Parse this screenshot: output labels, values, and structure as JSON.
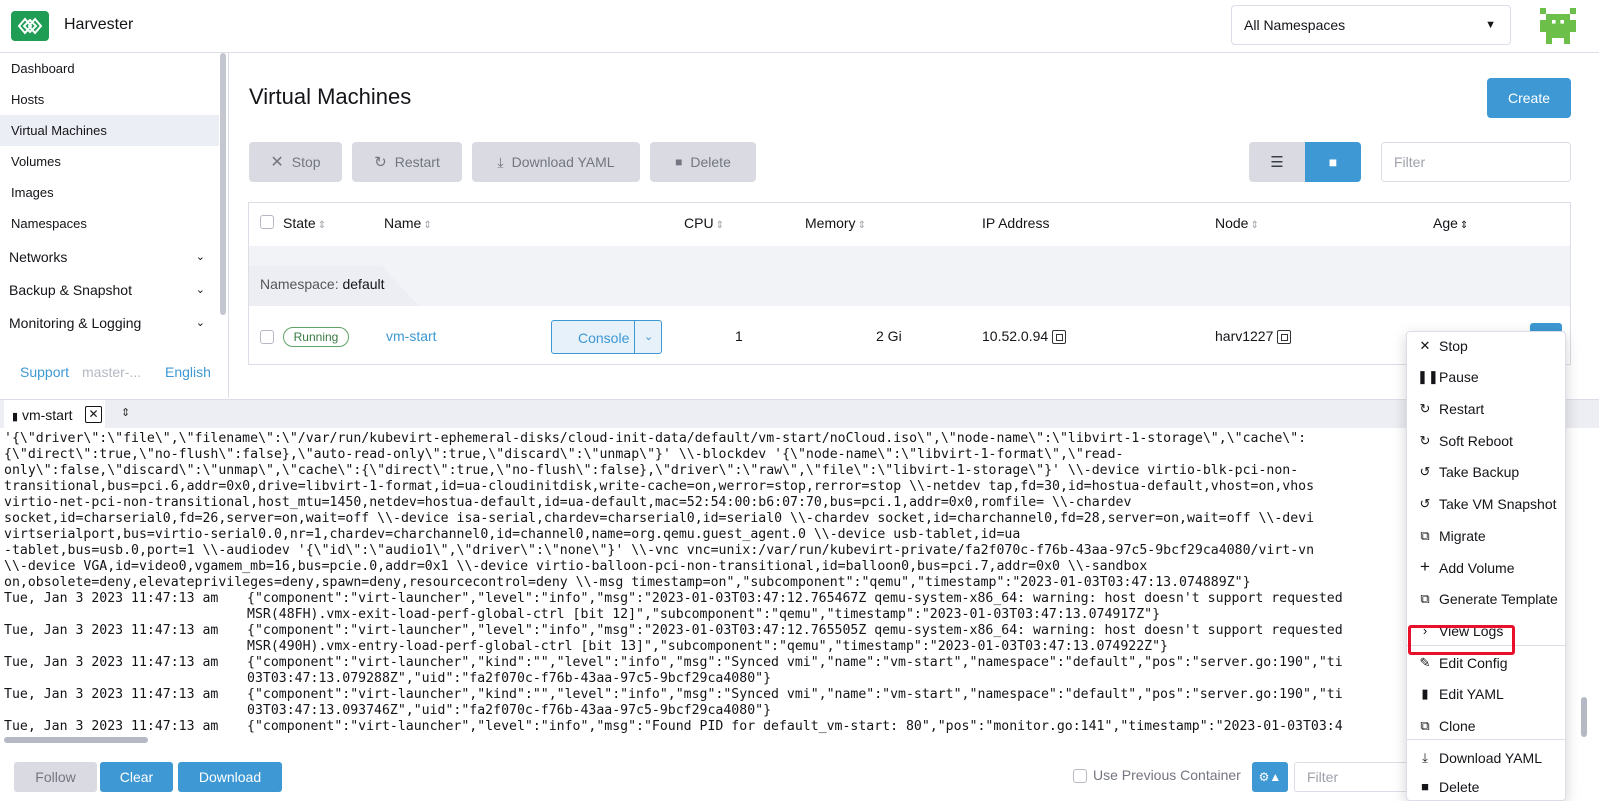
{
  "header": {
    "app_name": "Harvester",
    "namespace_select": "All Namespaces",
    "brand_color": "#1f9d55",
    "accent_color": "#3d98d3"
  },
  "sidebar": {
    "items": [
      {
        "label": "Dashboard"
      },
      {
        "label": "Hosts"
      },
      {
        "label": "Virtual Machines",
        "active": true
      },
      {
        "label": "Volumes"
      },
      {
        "label": "Images"
      },
      {
        "label": "Namespaces"
      }
    ],
    "groups": [
      {
        "label": "Networks"
      },
      {
        "label": "Backup & Snapshot"
      },
      {
        "label": "Monitoring & Logging"
      }
    ],
    "footer": {
      "support": "Support",
      "version": "master-...",
      "language": "English"
    }
  },
  "main": {
    "title": "Virtual Machines",
    "create_label": "Create",
    "bulk_actions": {
      "stop": "Stop",
      "restart": "Restart",
      "download_yaml": "Download YAML",
      "delete": "Delete"
    },
    "filter_placeholder": "Filter",
    "columns": {
      "state": "State",
      "name": "Name",
      "cpu": "CPU",
      "memory": "Memory",
      "ip": "IP Address",
      "node": "Node",
      "age": "Age"
    },
    "group_label": "Namespace:",
    "group_value": "default",
    "row": {
      "state": "Running",
      "name": "vm-start",
      "console": "Console",
      "cpu": "1",
      "memory": "2 Gi",
      "ip": "10.52.0.94",
      "node": "harv1227"
    }
  },
  "logs": {
    "tab_label": "vm-start",
    "wrapped_lines": [
      "'{\\\"driver\\\":\\\"file\\\",\\\"filename\\\":\\\"/var/run/kubevirt-ephemeral-disks/cloud-init-data/default/vm-start/noCloud.iso\\\",\\\"node-name\\\":\\\"libvirt-1-storage\\\",\\\"cache\\\":",
      "{\\\"direct\\\":true,\\\"no-flush\\\":false},\\\"auto-read-only\\\":true,\\\"discard\\\":\\\"unmap\\\"}' \\\\-blockdev '{\\\"node-name\\\":\\\"libvirt-1-format\\\",\\\"read-",
      "only\\\":false,\\\"discard\\\":\\\"unmap\\\",\\\"cache\\\":{\\\"direct\\\":true,\\\"no-flush\\\":false},\\\"driver\\\":\\\"raw\\\",\\\"file\\\":\\\"libvirt-1-storage\\\"}' \\\\-device virtio-blk-pci-non-",
      "transitional,bus=pci.6,addr=0x0,drive=libvirt-1-format,id=ua-cloudinitdisk,write-cache=on,werror=stop,rerror=stop \\\\-netdev tap,fd=30,id=hostua-default,vhost=on,vhos",
      "virtio-net-pci-non-transitional,host_mtu=1450,netdev=hostua-default,id=ua-default,mac=52:54:00:b6:07:70,bus=pci.1,addr=0x0,romfile= \\\\-chardev",
      "socket,id=charserial0,fd=26,server=on,wait=off \\\\-device isa-serial,chardev=charserial0,id=serial0 \\\\-chardev socket,id=charchannel0,fd=28,server=on,wait=off \\\\-devi",
      "virtserialport,bus=virtio-serial0.0,nr=1,chardev=charchannel0,id=channel0,name=org.qemu.guest_agent.0 \\\\-device usb-tablet,id=ua",
      "-tablet,bus=usb.0,port=1 \\\\-audiodev '{\\\"id\\\":\\\"audio1\\\",\\\"driver\\\":\\\"none\\\"}' \\\\-vnc vnc=unix:/var/run/kubevirt-private/fa2f070c-f76b-43aa-97c5-9bcf29ca4080/virt-vn",
      "\\\\-device VGA,id=video0,vgamem_mb=16,bus=pcie.0,addr=0x1 \\\\-device virtio-balloon-pci-non-transitional,id=balloon0,bus=pci.7,addr=0x0 \\\\-sandbox",
      "on,obsolete=deny,elevateprivileges=deny,spawn=deny,resourcecontrol=deny \\\\-msg timestamp=on\",\"subcomponent\":\"qemu\",\"timestamp\":\"2023-01-03T03:47:13.074889Z\"}"
    ],
    "entries": [
      {
        "ts": "Tue, Jan 3 2023 11:47:13 am",
        "l1": "{\"component\":\"virt-launcher\",\"level\":\"info\",\"msg\":\"2023-01-03T03:47:12.765467Z qemu-system-x86_64: warning: host doesn't support requested",
        "l2": "MSR(48FH).vmx-exit-load-perf-global-ctrl [bit 12]\",\"subcomponent\":\"qemu\",\"timestamp\":\"2023-01-03T03:47:13.074917Z\"}"
      },
      {
        "ts": "Tue, Jan 3 2023 11:47:13 am",
        "l1": "{\"component\":\"virt-launcher\",\"level\":\"info\",\"msg\":\"2023-01-03T03:47:12.765505Z qemu-system-x86_64: warning: host doesn't support requested",
        "l2": "MSR(490H).vmx-entry-load-perf-global-ctrl [bit 13]\",\"subcomponent\":\"qemu\",\"timestamp\":\"2023-01-03T03:47:13.074922Z\"}"
      },
      {
        "ts": "Tue, Jan 3 2023 11:47:13 am",
        "l1": "{\"component\":\"virt-launcher\",\"kind\":\"\",\"level\":\"info\",\"msg\":\"Synced vmi\",\"name\":\"vm-start\",\"namespace\":\"default\",\"pos\":\"server.go:190\",\"ti",
        "l2": "03T03:47:13.079288Z\",\"uid\":\"fa2f070c-f76b-43aa-97c5-9bcf29ca4080\"}"
      },
      {
        "ts": "Tue, Jan 3 2023 11:47:13 am",
        "l1": "{\"component\":\"virt-launcher\",\"kind\":\"\",\"level\":\"info\",\"msg\":\"Synced vmi\",\"name\":\"vm-start\",\"namespace\":\"default\",\"pos\":\"server.go:190\",\"ti",
        "l2": "03T03:47:13.093746Z\",\"uid\":\"fa2f070c-f76b-43aa-97c5-9bcf29ca4080\"}"
      },
      {
        "ts": "Tue, Jan 3 2023 11:47:13 am",
        "l1": "{\"component\":\"virt-launcher\",\"level\":\"info\",\"msg\":\"Found PID for default_vm-start: 80\",\"pos\":\"monitor.go:141\",\"timestamp\":\"2023-01-03T03:4",
        "l2": ""
      }
    ],
    "footer": {
      "follow": "Follow",
      "clear": "Clear",
      "download": "Download",
      "use_previous": "Use Previous Container",
      "filter_placeholder": "Filter"
    }
  },
  "context_menu": {
    "items": [
      {
        "label": "Stop",
        "icon": "close-icon"
      },
      {
        "label": "Pause",
        "icon": "pause-icon"
      },
      {
        "label": "Restart",
        "icon": "restart-icon"
      },
      {
        "label": "Soft Reboot",
        "icon": "restart-icon"
      },
      {
        "label": "Take Backup",
        "icon": "backup-icon"
      },
      {
        "label": "Take VM Snapshot",
        "icon": "snapshot-icon"
      },
      {
        "label": "Migrate",
        "icon": "copy-icon"
      },
      {
        "label": "Add Volume",
        "icon": "plus-icon"
      },
      {
        "label": "Generate Template",
        "icon": "copy-icon"
      },
      {
        "label": "View Logs",
        "icon": "chevron-right-icon",
        "highlighted": true
      },
      {
        "label": "Edit Config",
        "icon": "edit-icon"
      },
      {
        "label": "Edit YAML",
        "icon": "file-icon"
      },
      {
        "label": "Clone",
        "icon": "copy-icon"
      },
      {
        "label": "Download YAML",
        "icon": "download-icon"
      },
      {
        "label": "Delete",
        "icon": "trash-icon"
      }
    ],
    "highlight_color": "#e8102a"
  }
}
